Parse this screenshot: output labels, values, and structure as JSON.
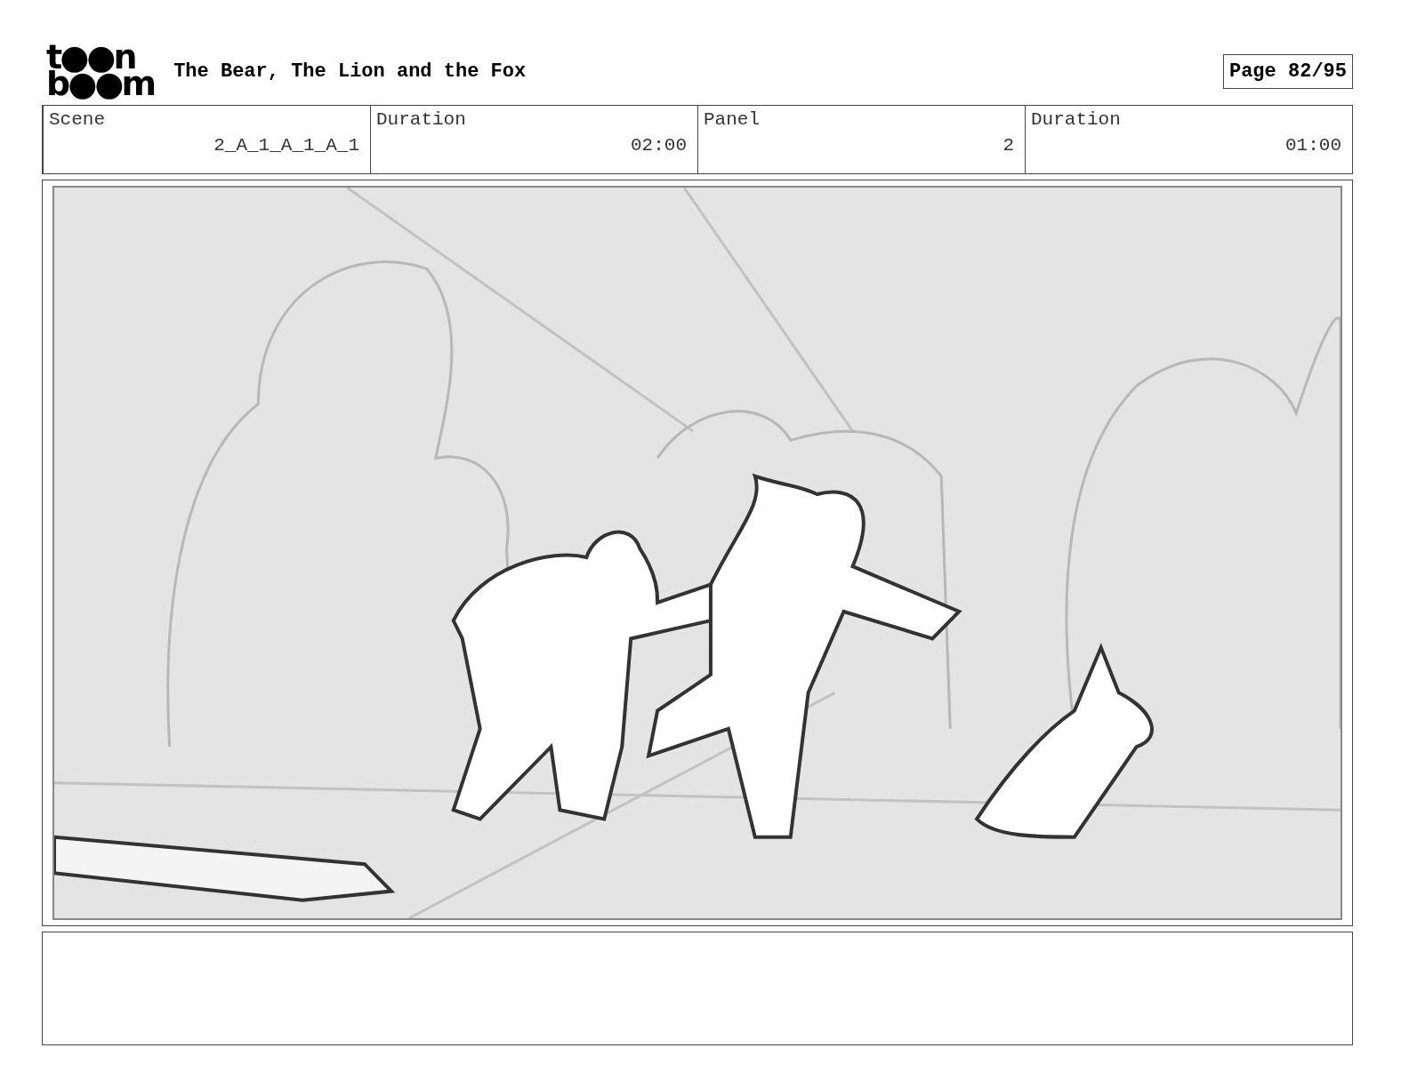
{
  "logo": [
    "t●●n",
    "b●●m"
  ],
  "title": "The Bear, The Lion and the Fox",
  "page": "Page 82/95",
  "info": [
    {
      "label": "Scene",
      "value": "2_A_1_A_1_A_1"
    },
    {
      "label": "Duration",
      "value": "02:00"
    },
    {
      "label": "Panel",
      "value": "2"
    },
    {
      "label": "Duration",
      "value": "01:00"
    }
  ]
}
